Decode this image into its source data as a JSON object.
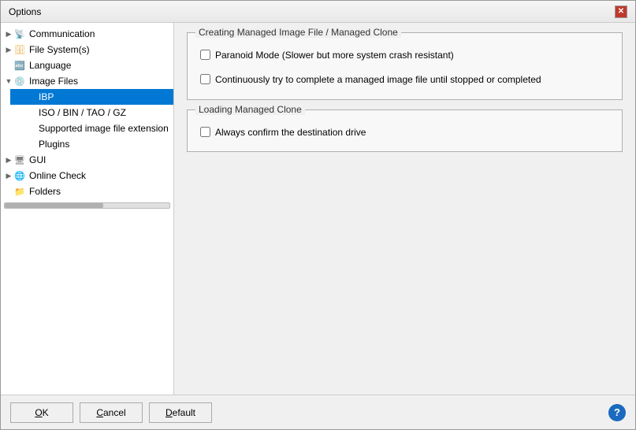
{
  "window": {
    "title": "Options",
    "close_label": "✕"
  },
  "sidebar": {
    "items": [
      {
        "id": "communication",
        "label": "Communication",
        "level": 0,
        "arrow": "collapsed",
        "icon": "comm",
        "selected": false
      },
      {
        "id": "filesystem",
        "label": "File System(s)",
        "level": 0,
        "arrow": "collapsed",
        "icon": "fs",
        "selected": false
      },
      {
        "id": "language",
        "label": "Language",
        "level": 0,
        "arrow": "leaf",
        "icon": "lang",
        "selected": false
      },
      {
        "id": "imagefiles",
        "label": "Image Files",
        "level": 0,
        "arrow": "expanded",
        "icon": "img",
        "selected": false
      },
      {
        "id": "ibp",
        "label": "IBP",
        "level": 1,
        "arrow": "leaf",
        "icon": "none",
        "selected": true
      },
      {
        "id": "iso",
        "label": "ISO / BIN / TAO / GZ",
        "level": 1,
        "arrow": "leaf",
        "icon": "none",
        "selected": false
      },
      {
        "id": "supported",
        "label": "Supported image file extension",
        "level": 1,
        "arrow": "leaf",
        "icon": "none",
        "selected": false
      },
      {
        "id": "plugins",
        "label": "Plugins",
        "level": 1,
        "arrow": "leaf",
        "icon": "none",
        "selected": false
      },
      {
        "id": "gui",
        "label": "GUI",
        "level": 0,
        "arrow": "collapsed",
        "icon": "gui",
        "selected": false
      },
      {
        "id": "onlinecheck",
        "label": "Online Check",
        "level": 0,
        "arrow": "collapsed",
        "icon": "online",
        "selected": false
      },
      {
        "id": "folders",
        "label": "Folders",
        "level": 0,
        "arrow": "leaf",
        "icon": "folder",
        "selected": false
      }
    ]
  },
  "content": {
    "section1": {
      "title": "Creating Managed Image File / Managed Clone",
      "checkboxes": [
        {
          "id": "paranoid",
          "label": "Paranoid Mode (Slower but more system crash resistant)",
          "checked": false
        },
        {
          "id": "continuous",
          "label": "Continuously try to complete a managed image file until stopped or completed",
          "checked": false
        }
      ]
    },
    "section2": {
      "title": "Loading Managed Clone",
      "checkboxes": [
        {
          "id": "confirm",
          "label": "Always confirm the destination drive",
          "checked": false
        }
      ]
    }
  },
  "footer": {
    "ok_label": "OK",
    "cancel_label": "Cancel",
    "default_label": "Default",
    "help_label": "?"
  }
}
